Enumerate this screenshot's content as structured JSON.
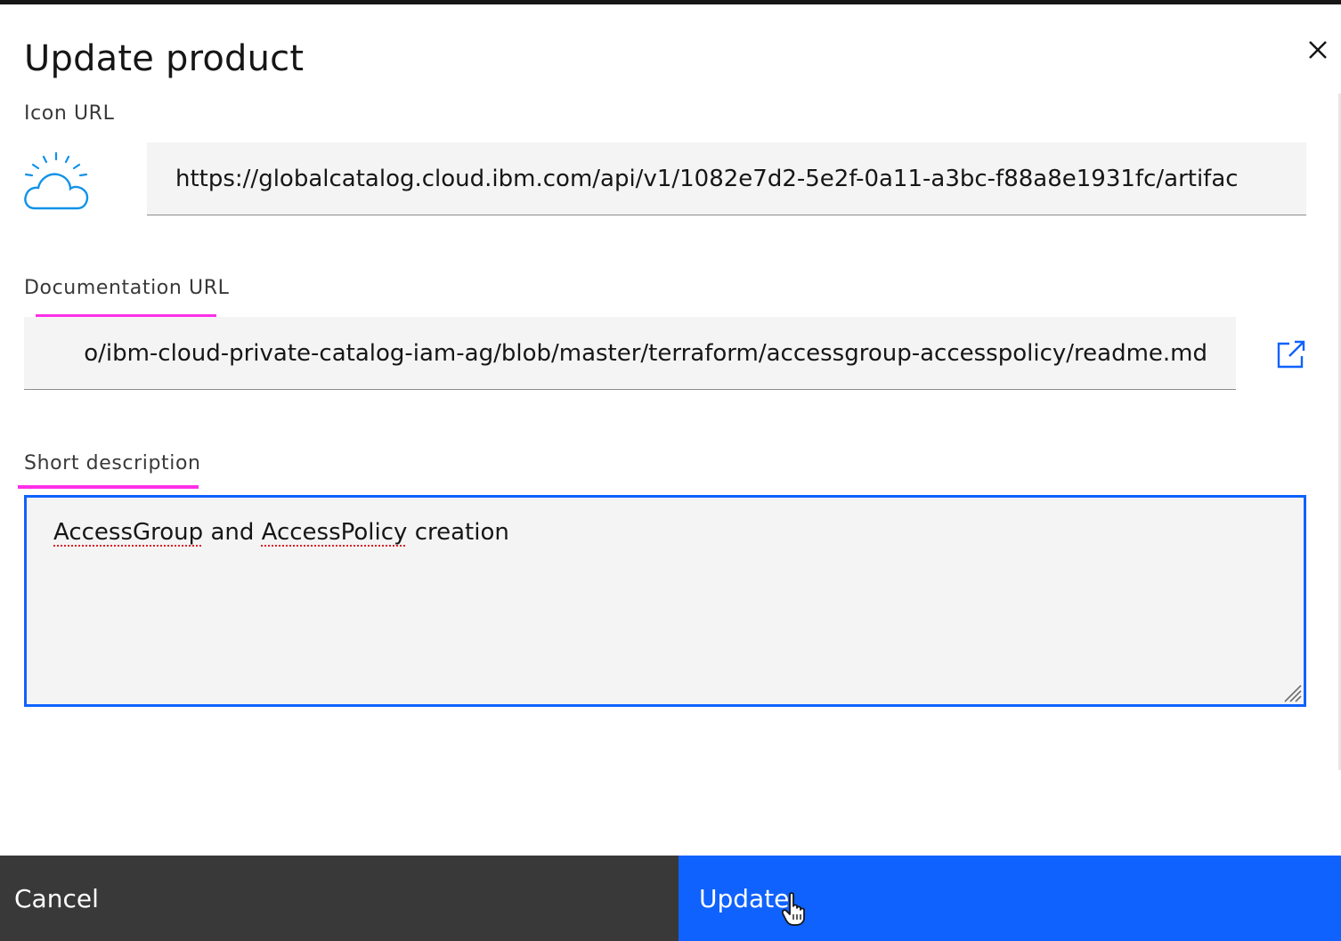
{
  "modal": {
    "title": "Update product",
    "close_icon": "close-icon"
  },
  "icon_url": {
    "label": "Icon URL",
    "value": "https://globalcatalog.cloud.ibm.com/api/v1/1082e7d2-5e2f-0a11-a3bc-f88a8e1931fc/artifac",
    "preview_icon": "ibm-cloud-icon"
  },
  "documentation_url": {
    "label": "Documentation URL",
    "value": "o/ibm-cloud-private-catalog-iam-ag/blob/master/terraform/accessgroup-accesspolicy/readme.md",
    "launch_icon": "launch-icon"
  },
  "short_description": {
    "label": "Short description",
    "word1": "AccessGroup",
    "word2": "and",
    "word3": "AccessPolicy",
    "word4": "creation"
  },
  "footer": {
    "cancel_label": "Cancel",
    "update_label": "Update"
  },
  "colors": {
    "primary": "#0f62fe",
    "secondary_button": "#393939",
    "highlight_underline": "#ff2fe8",
    "field_background": "#f4f4f4"
  }
}
